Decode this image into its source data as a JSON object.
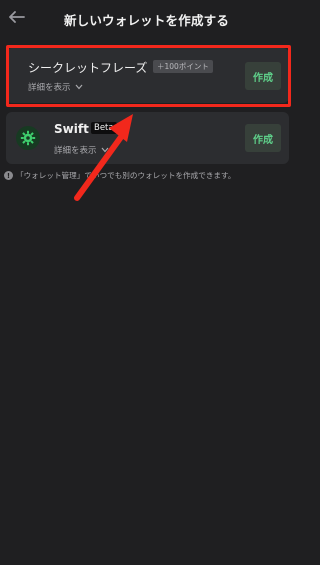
{
  "header": {
    "title": "新しいウォレットを作成する",
    "back_icon": "arrow-left-icon"
  },
  "options": [
    {
      "title": "シークレットフレーズ",
      "badge": "＋100ポイント",
      "details_label": "詳細を表示",
      "create_label": "作成"
    },
    {
      "title": "Swift",
      "badge": "Beta",
      "details_label": "詳細を表示",
      "create_label": "作成",
      "logo_icon": "swift-gear-icon"
    }
  ],
  "note": {
    "text": "「ウォレット管理」でいつでも別のウォレットを作成できます。"
  },
  "colors": {
    "background": "#1f1f21",
    "card": "#2c2d30",
    "accent_green": "#5fd08a",
    "annotation_red": "#f2281c"
  }
}
